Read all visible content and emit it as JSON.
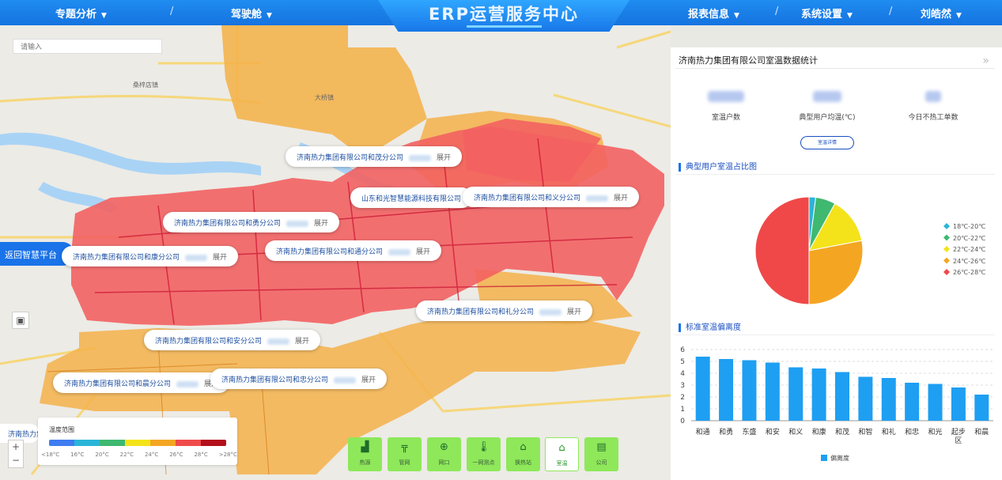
{
  "header": {
    "title": "ERP运营服务中心",
    "nav_left": [
      {
        "label": "专题分析",
        "caret": "▼"
      },
      {
        "label": "驾驶舱",
        "caret": "▼"
      }
    ],
    "nav_right": [
      {
        "label": "报表信息",
        "caret": "▼"
      },
      {
        "label": "系统设置",
        "caret": "▼"
      },
      {
        "label": "刘皓然",
        "caret": "▼"
      }
    ],
    "separator": "/"
  },
  "search": {
    "placeholder": "请输入"
  },
  "return_button": {
    "label": "返回智慧平台",
    "chevron": "«"
  },
  "map": {
    "place_labels": [
      "桑梓店镇",
      "大桥镇"
    ],
    "company_labels": [
      {
        "name": "济南热力集团有限公司和茂分公司",
        "action": "展开"
      },
      {
        "name": "山东和光智慧能源科技有限公司",
        "action": ""
      },
      {
        "name": "济南热力集团有限公司和义分公司",
        "action": "展开"
      },
      {
        "name": "济南热力集团有限公司和勇分公司",
        "action": "展开"
      },
      {
        "name": "济南热力集团有限公司和康分公司",
        "action": "展开"
      },
      {
        "name": "济南热力集团有限公司和通分公司",
        "action": "展开"
      },
      {
        "name": "济南热力集团有限公司和礼分公司",
        "action": "展开"
      },
      {
        "name": "济南热力集团有限公司和安分公司",
        "action": "展开"
      },
      {
        "name": "济南热力集团有限公司和晨分公司",
        "action": "展开"
      },
      {
        "name": "济南热力集团有限公司和忠分公司",
        "action": "展开"
      }
    ],
    "partial_label": "济南热力集"
  },
  "legend": {
    "title": "温度范围",
    "colors": [
      "#3f7cf0",
      "#2ab5d8",
      "#3fb870",
      "#f4e31a",
      "#f4a623",
      "#ef4b4b",
      "#b3101b"
    ],
    "ticks": [
      "<18°C",
      "16°C",
      "20°C",
      "22°C",
      "24°C",
      "26°C",
      "28°C",
      ">28°C"
    ]
  },
  "zoom": {
    "plus": "+",
    "minus": "−"
  },
  "bottom_buttons": [
    {
      "label": "热源",
      "icon": "factory-icon",
      "active": false
    },
    {
      "label": "管网",
      "icon": "pipe-icon",
      "active": false
    },
    {
      "label": "网口",
      "icon": "valve-icon",
      "active": false
    },
    {
      "label": "一网测点",
      "icon": "thermometer-icon",
      "active": false
    },
    {
      "label": "换热站",
      "icon": "house-icon",
      "active": false
    },
    {
      "label": "室温",
      "icon": "home-temp-icon",
      "active": true
    },
    {
      "label": "公司",
      "icon": "building-icon",
      "active": false
    }
  ],
  "panel": {
    "title": "济南热力集团有限公司室温数据统计",
    "collapse": "»",
    "stats": [
      {
        "label": "室温户数"
      },
      {
        "label": "典型用户均温(℃)"
      },
      {
        "label": "今日不热工单数"
      }
    ],
    "detail_button": "室温详情",
    "pie_section_title": "典型用户室温占比图",
    "bar_section_title": "标准室温偏离度"
  },
  "colors": {
    "pie": [
      "#2ab5d8",
      "#3fb870",
      "#f4e31a",
      "#f4a623",
      "#f04848"
    ],
    "bar": "#1e9ff2",
    "map_red": "#f36262",
    "map_orange": "#f4b24a"
  },
  "chart_data": [
    {
      "type": "pie",
      "title": "典型用户室温占比图",
      "legend_position": "right",
      "slices": [
        {
          "label": "18℃-20℃",
          "value": 2
        },
        {
          "label": "20℃-22℃",
          "value": 6
        },
        {
          "label": "22℃-24℃",
          "value": 14
        },
        {
          "label": "24℃-26℃",
          "value": 28
        },
        {
          "label": "26℃-28℃",
          "value": 50
        }
      ]
    },
    {
      "type": "bar",
      "title": "标准室温偏离度",
      "categories": [
        "和通",
        "和勇",
        "东盛",
        "和安",
        "和义",
        "和康",
        "和茂",
        "和智",
        "和礼",
        "和忠",
        "和光",
        "起步区",
        "和晨"
      ],
      "series": [
        {
          "name": "偏离度",
          "values": [
            5.4,
            5.2,
            5.1,
            4.9,
            4.5,
            4.4,
            4.1,
            3.7,
            3.6,
            3.2,
            3.1,
            2.8,
            2.2
          ]
        }
      ],
      "ylim": [
        0,
        6
      ],
      "yticks": [
        0,
        1,
        2,
        3,
        4,
        5,
        6
      ],
      "grid": true,
      "legend_position": "bottom"
    }
  ]
}
